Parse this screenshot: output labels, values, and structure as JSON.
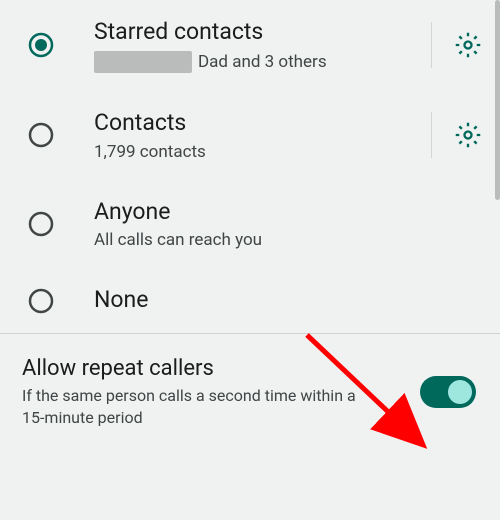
{
  "options": {
    "starred": {
      "title": "Starred contacts",
      "subtitle_suffix": "Dad and 3 others",
      "selected": true,
      "has_gear": true
    },
    "contacts": {
      "title": "Contacts",
      "subtitle": "1,799 contacts",
      "selected": false,
      "has_gear": true
    },
    "anyone": {
      "title": "Anyone",
      "subtitle": "All calls can reach you",
      "selected": false,
      "has_gear": false
    },
    "none": {
      "title": "None",
      "selected": false,
      "has_gear": false
    }
  },
  "repeat_callers": {
    "title": "Allow repeat callers",
    "subtitle": "If the same person calls a second time within a 15-minute period",
    "enabled": true
  },
  "colors": {
    "accent": "#00695c"
  }
}
